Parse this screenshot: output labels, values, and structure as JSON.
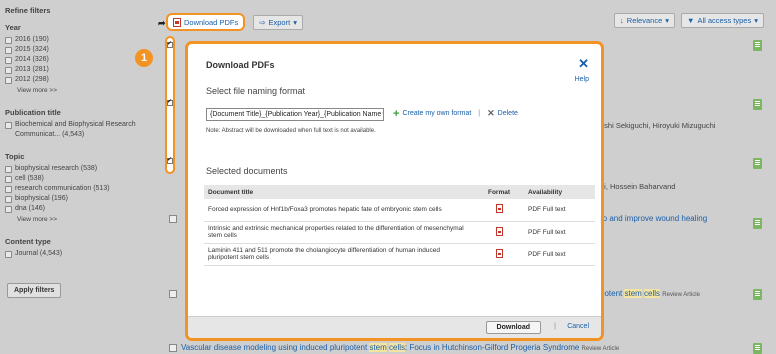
{
  "sidebar": {
    "title": "Refine filters",
    "groups": [
      {
        "title": "Year",
        "items": [
          "2016 (190)",
          "2015 (324)",
          "2014 (326)",
          "2013 (281)",
          "2012 (298)"
        ],
        "more": "View more >>"
      },
      {
        "title": "Publication title",
        "items": [
          "Biochemical and Biophysical Research Communicat... (4,543)"
        ]
      },
      {
        "title": "Topic",
        "items": [
          "biophysical research (538)",
          "cell (538)",
          "research communication (513)",
          "biophysical (196)",
          "dna (146)"
        ],
        "more": "View more >>"
      },
      {
        "title": "Content type",
        "items": [
          "Journal (4,543)"
        ]
      }
    ],
    "apply_label": "Apply filters"
  },
  "toolbar": {
    "download_label": "Download PDFs",
    "export_label": "Export",
    "relevance_label": "Relevance",
    "access_label": "All access types"
  },
  "background": {
    "snippet1": "oshi Sekiguchi, Hiroyuki Mizuguchi",
    "snippet2": "hi, Hossein Baharvand",
    "snippet3": "ro and improve wound healing",
    "snippet4_pre": "potent ",
    "snippet4_hl1": "stem",
    "snippet4_hl2": "cells",
    "snippet4_badge": "Review Article",
    "bottom_pre": "Vascular disease modeling using induced pluripotent ",
    "bottom_hl1": "stem",
    "bottom_hl2": "cells",
    "bottom_post": ": Focus in Hutchinson-Gilford Progeria Syndrome",
    "bottom_badge": "Review Article"
  },
  "step_number": "1",
  "modal": {
    "title": "Download PDFs",
    "help": "Help",
    "naming_heading": "Select file naming format",
    "naming_value": "{Document Title}_{Publication Year}_{Publication Name",
    "create_label": "Create my own format",
    "delete_label": "Delete",
    "note": "Note: Abstract will be downloaded when full text is not available.",
    "selected_heading": "Selected documents",
    "columns": [
      "Document title",
      "Format",
      "Availability"
    ],
    "rows": [
      {
        "title": "Forced expression of Hnf1b/Foxa3 promotes hepatic fate of embryonic stem cells",
        "availability": "PDF Full text"
      },
      {
        "title": "Intrinsic and extrinsic mechanical properties related to the differentiation of mesenchymal stem cells",
        "availability": "PDF Full text"
      },
      {
        "title": "Laminin 411 and 511 promote the cholangiocyte differentiation of human induced pluripotent stem cells",
        "availability": "PDF Full text"
      }
    ],
    "download_label": "Download",
    "cancel_label": "Cancel"
  }
}
